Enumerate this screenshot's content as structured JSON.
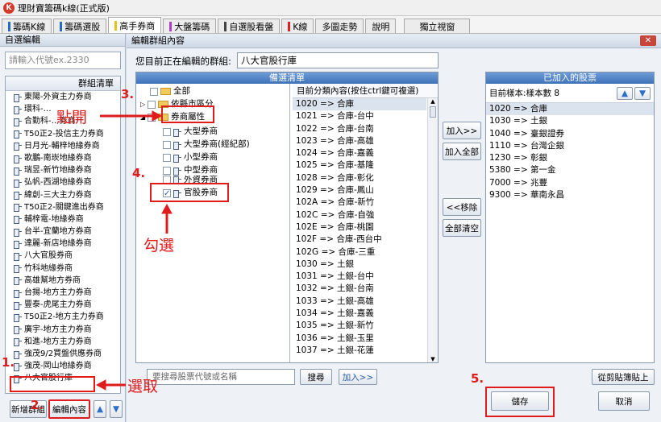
{
  "window": {
    "title": "理財寶籌碼k線(正式版)",
    "icon_text": "K"
  },
  "tabs": [
    {
      "label": "籌碼K線",
      "mark": "#2a68c8"
    },
    {
      "label": "籌碼選股",
      "mark": "#2a68c8"
    },
    {
      "label": "高手券商",
      "mark": "#e8c020"
    },
    {
      "label": "大盤籌碼",
      "mark": "#b03cc8"
    },
    {
      "label": "自選股看盤",
      "mark": "#444444"
    },
    {
      "label": "K線",
      "mark": "#d82020"
    },
    {
      "label": "多圖走勢",
      "mark": ""
    },
    {
      "label": "說明",
      "mark": ""
    },
    {
      "label": "獨立視窗",
      "mark": ""
    }
  ],
  "left": {
    "header": "自選編輯",
    "search_placeholder": "請輸入代號ex.2330",
    "list_header": "群組清單",
    "groups": [
      "東陽-外資主力券商",
      "環科-…",
      "合勤科-…券商",
      "T50正2-投信主力券商",
      "日月光-輔梓地緣券商",
      "歌鵬-南崁地緣券商",
      "瑞昱-新竹地緣券商",
      "弘帆-西湖地緣券商",
      "緯創-三大主力券商",
      "T50正2-關鍵進出券商",
      "輔梓電-地緣券商",
      "台半-宜蘭地方券商",
      "達麗-新店地緣券商",
      "八大官股券商",
      "竹科地緣券商",
      "高雄幫地方券商",
      "台揚-地方主力券商",
      "豐泰-虎尾主力券商",
      "T50正2-地方主力券商",
      "廣宇-地方主力券商",
      "和進-地方主力券商",
      "強茂9/2買盤供應券商",
      "強茂-岡山地緣券商",
      "八大官股行庫"
    ],
    "btn_new": "新增群組",
    "btn_edit": "編輯內容",
    "btn_up": "▲",
    "btn_down": "▼"
  },
  "dialog": {
    "title": "編輯群組內容",
    "close": "✕",
    "editing_label": "您目前正在編輯的群組:",
    "editing_value": "八大官股行庫",
    "candidates_header": "備選清單",
    "tree": {
      "all": "全部",
      "geo": "依縣市區分",
      "broker_attr": "券商屬性",
      "large": "大型券商",
      "large_ops": "大型券商(經紀部)",
      "small": "小型券商",
      "medium": "中型券商",
      "foreign": "外資券商",
      "gov": "官股券商"
    },
    "classify_header": "目前分類內容(按住ctrl鍵可複選)",
    "classify_items": [
      "1020 => 合庫",
      "1021 => 合庫-台中",
      "1022 => 合庫-台南",
      "1023 => 合庫-高雄",
      "1024 => 合庫-嘉義",
      "1025 => 合庫-基隆",
      "1028 => 合庫-彰化",
      "1029 => 合庫-鳳山",
      "102A => 合庫-新竹",
      "102C => 合庫-自強",
      "102E => 合庫-桃園",
      "102F => 合庫-西台中",
      "102G => 合庫-三重",
      "1030 => 土銀",
      "1031 => 土銀-台中",
      "1032 => 土銀-台南",
      "1033 => 土銀-高雄",
      "1034 => 土銀-嘉義",
      "1035 => 土銀-新竹",
      "1036 => 土銀-玉里",
      "1037 => 土銀-花蓮"
    ],
    "btn_add": "加入>>",
    "btn_add_all": "加入全部",
    "btn_remove": "<<移除",
    "btn_clear": "全部清空",
    "added_header": "已加入的股票",
    "sample_label": "目前樣本:樣本數 8",
    "added_items": [
      "1020 => 合庫",
      "1030 => 土銀",
      "1040 => 臺銀證券",
      "1110 => 台灣企銀",
      "1230 => 彰銀",
      "5380 => 第一金",
      "7000 => 兆豐",
      "9300 => 華南永昌"
    ],
    "search_placeholder": "要搜尋股票代號或名稱",
    "btn_search": "搜尋",
    "btn_add2": "加入>>",
    "btn_paste": "從剪貼簿貼上",
    "btn_save": "儲存",
    "btn_cancel": "取消"
  },
  "annotations": {
    "n1": "1.",
    "n2": "2.",
    "n3": "3.",
    "n4": "4.",
    "n5": "5.",
    "click_open": "點開",
    "check": "勾選",
    "select": "選取"
  },
  "colors": {
    "annotation": "#e01b1b",
    "header_blue": "#3e72b8"
  }
}
